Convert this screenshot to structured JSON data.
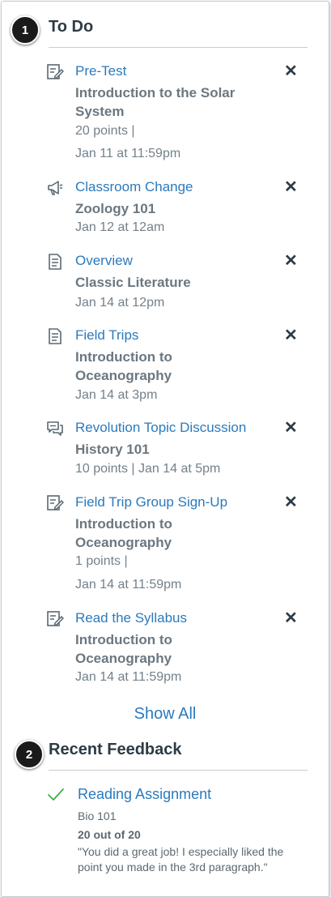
{
  "callouts": [
    "1",
    "2"
  ],
  "todo": {
    "heading": "To Do",
    "items": [
      {
        "icon": "quiz-icon",
        "title": "Pre-Test",
        "course": "Introduction to the Solar System",
        "meta1": "20 points  |",
        "meta2": "Jan 11 at 11:59pm"
      },
      {
        "icon": "announcement-icon",
        "title": "Classroom Change",
        "course": "Zoology 101",
        "meta1": "Jan 12 at 12am",
        "meta2": ""
      },
      {
        "icon": "page-icon",
        "title": "Overview",
        "course": "Classic Literature",
        "meta1": "Jan 14 at 12pm",
        "meta2": ""
      },
      {
        "icon": "page-icon",
        "title": "Field Trips",
        "course": "Introduction to Oceanography",
        "meta1": "Jan 14 at 3pm",
        "meta2": ""
      },
      {
        "icon": "discussion-icon",
        "title": "Revolution Topic Discussion",
        "course": "History 101",
        "meta1": "10 points  |  Jan 14 at 5pm",
        "meta2": ""
      },
      {
        "icon": "quiz-icon",
        "title": "Field Trip Group Sign-Up",
        "course": "Introduction to Oceanography",
        "meta1": "1 points  |",
        "meta2": "Jan 14 at 11:59pm"
      },
      {
        "icon": "quiz-icon",
        "title": "Read the Syllabus",
        "course": "Introduction to Oceanography",
        "meta1": "Jan 14 at 11:59pm",
        "meta2": ""
      }
    ],
    "show_all": "Show All"
  },
  "feedback": {
    "heading": "Recent Feedback",
    "title": "Reading Assignment",
    "course": "Bio 101",
    "score": "20 out of 20",
    "comment": "\"You did a great job! I especially liked the point you made in the 3rd paragraph.\""
  },
  "colors": {
    "link": "#2b7abc",
    "check": "#3fae49",
    "text": "#2d3b45"
  }
}
